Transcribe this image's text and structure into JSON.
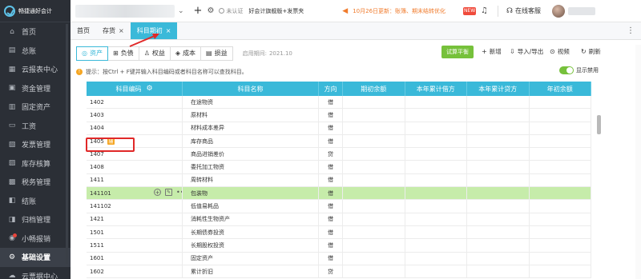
{
  "app": {
    "name": "畅捷通好会计"
  },
  "sidebar": {
    "items": [
      {
        "label": "首页",
        "icon": "home-icon",
        "glyph": "⌂"
      },
      {
        "label": "总账",
        "icon": "ledger-icon",
        "glyph": "▤"
      },
      {
        "label": "云报表中心",
        "icon": "report-icon",
        "glyph": "▦"
      },
      {
        "label": "资金管理",
        "icon": "wallet-icon",
        "glyph": "▣"
      },
      {
        "label": "固定资产",
        "icon": "building-icon",
        "glyph": "▥"
      },
      {
        "label": "工资",
        "icon": "payroll-icon",
        "glyph": "▭"
      },
      {
        "label": "发票管理",
        "icon": "invoice-icon",
        "glyph": "▧"
      },
      {
        "label": "库存核算",
        "icon": "inventory-icon",
        "glyph": "▨"
      },
      {
        "label": "税务管理",
        "icon": "tax-icon",
        "glyph": "▩"
      },
      {
        "label": "结账",
        "icon": "checkout-icon",
        "glyph": "◧"
      },
      {
        "label": "归档管理",
        "icon": "archive-icon",
        "glyph": "◨"
      },
      {
        "label": "小畅报销",
        "icon": "reimburse-icon",
        "glyph": "◉"
      },
      {
        "label": "基础设置",
        "icon": "settings-icon",
        "glyph": "⚙"
      },
      {
        "label": "云票据中心",
        "icon": "cloud-icon",
        "glyph": "☁"
      }
    ]
  },
  "topbar": {
    "auth": "未认证",
    "friends": "好会计旗舰版+发票夹",
    "news": "10月26日更新：账簿、期末结转优化",
    "gift_label": "NEW",
    "service": "在线客服"
  },
  "tabs": [
    {
      "label": "首页",
      "closable": false
    },
    {
      "label": "存货",
      "closable": true
    },
    {
      "label": "科目期初",
      "closable": true,
      "active": true
    }
  ],
  "categories": [
    {
      "label": "资产",
      "icon": "asset-icon",
      "glyph": "◎",
      "active": true
    },
    {
      "label": "负债",
      "icon": "liability-icon",
      "glyph": "⊞"
    },
    {
      "label": "权益",
      "icon": "equity-icon",
      "glyph": "♙"
    },
    {
      "label": "成本",
      "icon": "cost-icon",
      "glyph": "◈"
    },
    {
      "label": "损益",
      "icon": "profit-icon",
      "glyph": "▤"
    }
  ],
  "period": {
    "label": "启用期间:",
    "value": "2021.10"
  },
  "toolbar": {
    "trial_balance": "试算平衡",
    "add": "新增",
    "import_export": "导入/导出",
    "video": "视频",
    "refresh": "刷新"
  },
  "hint": {
    "text": "提示：按Ctrl + F键并输入科目编码或者科目名称可以查找科目。",
    "toggle_label": "显示禁用",
    "toggle_on": true
  },
  "table": {
    "columns": [
      "科目编码",
      "科目名称",
      "方向",
      "期初余额",
      "本年累计借方",
      "本年累计贷方",
      "年初余额"
    ],
    "rows": [
      {
        "code": "1402",
        "name": "在途物资",
        "dir": "借"
      },
      {
        "code": "1403",
        "name": "原材料",
        "dir": "借"
      },
      {
        "code": "1404",
        "name": "材料成本差异",
        "dir": "借"
      },
      {
        "code": "1405",
        "name": "库存商品",
        "dir": "借",
        "tag": "辅",
        "highlighted": true
      },
      {
        "code": "1407",
        "name": "商品进销差价",
        "dir": "贷"
      },
      {
        "code": "1408",
        "name": "委托加工物资",
        "dir": "借"
      },
      {
        "code": "1411",
        "name": "周转材料",
        "dir": "借"
      },
      {
        "code": "141101",
        "name": "包装物",
        "dir": "借",
        "selected": true
      },
      {
        "code": "141102",
        "name": "低值易耗品",
        "dir": "借"
      },
      {
        "code": "1421",
        "name": "消耗性生物资产",
        "dir": "借"
      },
      {
        "code": "1501",
        "name": "长期债券投资",
        "dir": "借"
      },
      {
        "code": "1511",
        "name": "长期股权投资",
        "dir": "借"
      },
      {
        "code": "1601",
        "name": "固定资产",
        "dir": "借"
      },
      {
        "code": "1602",
        "name": "累计折旧",
        "dir": "贷"
      }
    ]
  },
  "colors": {
    "accent": "#3ab9d9",
    "green": "#76c13b",
    "selected_row": "#c6ecaa",
    "highlight": "#e02828",
    "sidebar": "#2b2f36"
  }
}
